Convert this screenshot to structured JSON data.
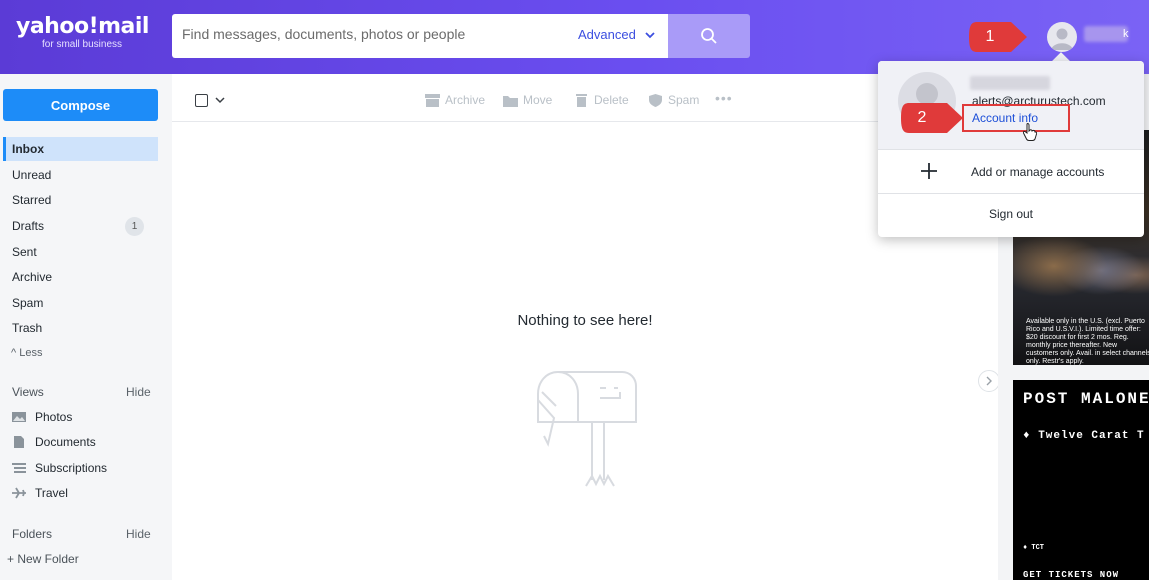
{
  "brand": {
    "logo_text": "yahoo!mail",
    "logo_sub": "for small business"
  },
  "search": {
    "placeholder": "Find messages, documents, photos or people",
    "advanced_label": "Advanced"
  },
  "header_user": {
    "name_suffix": "k"
  },
  "sidebar": {
    "compose_label": "Compose",
    "items": [
      {
        "label": "Inbox",
        "active": true
      },
      {
        "label": "Unread"
      },
      {
        "label": "Starred"
      },
      {
        "label": "Drafts",
        "badge": "1"
      },
      {
        "label": "Sent"
      },
      {
        "label": "Archive"
      },
      {
        "label": "Spam"
      },
      {
        "label": "Trash"
      }
    ],
    "less_label": "Less",
    "views_header": "Views",
    "views_hide": "Hide",
    "views": [
      {
        "label": "Photos",
        "icon": "photo-icon"
      },
      {
        "label": "Documents",
        "icon": "document-icon"
      },
      {
        "label": "Subscriptions",
        "icon": "subscriptions-icon"
      },
      {
        "label": "Travel",
        "icon": "plane-icon"
      }
    ],
    "folders_header": "Folders",
    "folders_hide": "Hide",
    "new_folder_label": "+ New Folder"
  },
  "toolbar": {
    "archive_label": "Archive",
    "move_label": "Move",
    "delete_label": "Delete",
    "spam_label": "Spam",
    "more_label": "•••"
  },
  "main": {
    "empty_message": "Nothing to see here!"
  },
  "account_menu": {
    "email": "alerts@arcturustech.com",
    "account_info_label": "Account info",
    "add_manage_label": "Add or manage accounts",
    "sign_out_label": "Sign out"
  },
  "annotations": {
    "step1": "1",
    "step2": "2",
    "color": "#e03a3a"
  },
  "ads": {
    "ad1_text": "Available only in the U.S. (excl. Puerto Rico and U.S.V.I.). Limited time offer: $20 discount for first 2 mos. Reg. monthly price thereafter. New customers only. Avail. in select channels only. Restr's apply.",
    "ad2_headline": "POST MALONE",
    "ad2_sub": "♦ Twelve Carat T",
    "ad2_tag": "♦ TCT",
    "ad2_cta": "GET TICKETS NOW"
  },
  "colors": {
    "header": "#6a4ef0",
    "compose": "#1d8cf8",
    "link": "#1d4fd8"
  }
}
